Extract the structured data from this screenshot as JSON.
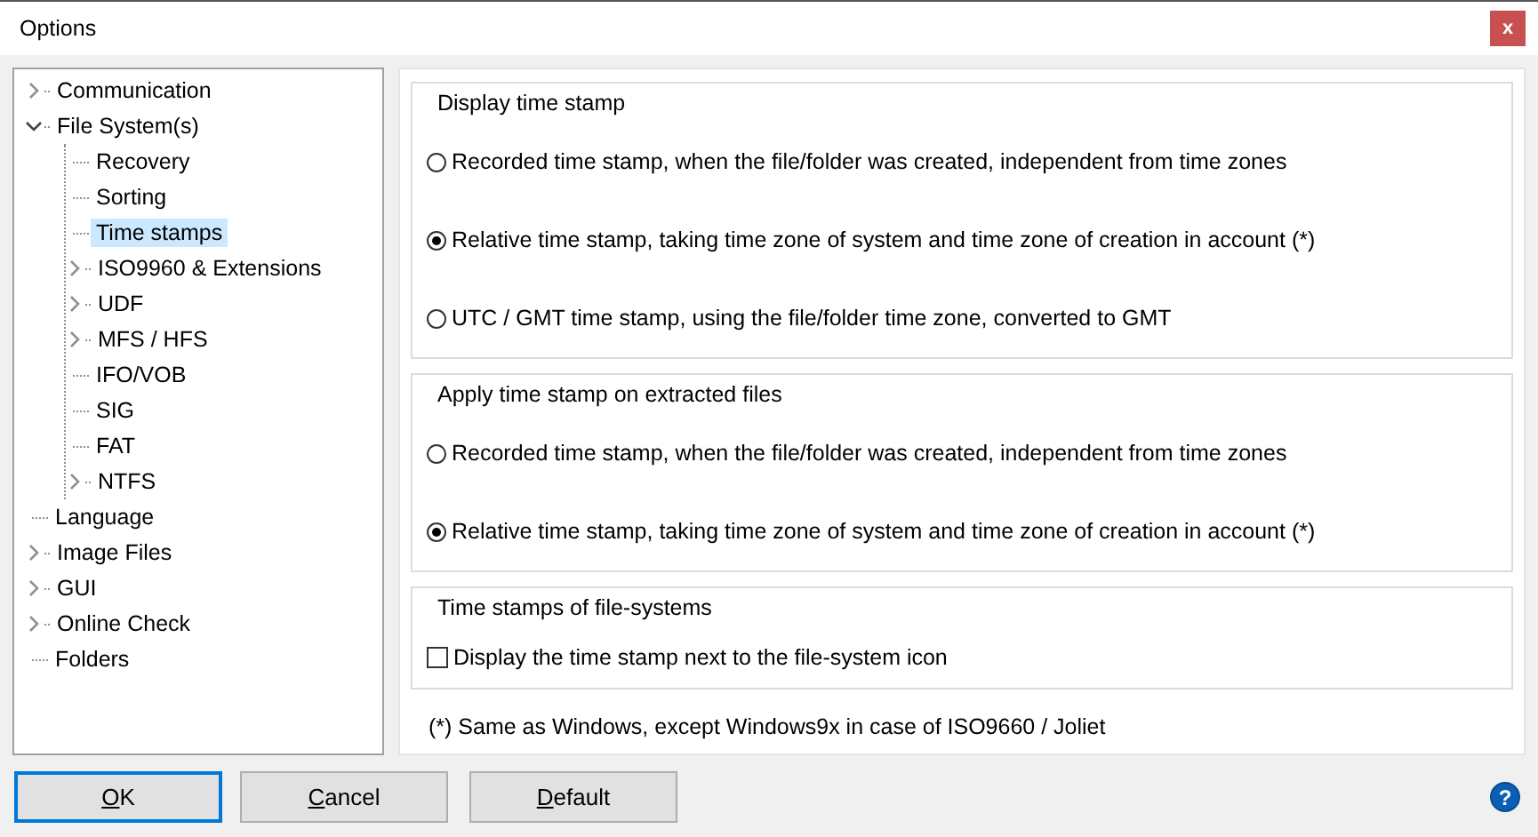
{
  "window": {
    "title": "Options",
    "close": "x"
  },
  "tree": [
    {
      "label": "Communication",
      "kind": "branch",
      "expanded": false,
      "selected": false
    },
    {
      "label": "File System(s)",
      "kind": "branch",
      "expanded": true,
      "selected": false,
      "children": [
        {
          "label": "Recovery",
          "kind": "leaf",
          "selected": false
        },
        {
          "label": "Sorting",
          "kind": "leaf",
          "selected": false
        },
        {
          "label": "Time stamps",
          "kind": "leaf",
          "selected": true
        },
        {
          "label": "ISO9960 & Extensions",
          "kind": "branch",
          "expanded": false,
          "selected": false
        },
        {
          "label": "UDF",
          "kind": "branch",
          "expanded": false,
          "selected": false
        },
        {
          "label": "MFS / HFS",
          "kind": "branch",
          "expanded": false,
          "selected": false
        },
        {
          "label": "IFO/VOB",
          "kind": "leaf",
          "selected": false
        },
        {
          "label": "SIG",
          "kind": "leaf",
          "selected": false
        },
        {
          "label": "FAT",
          "kind": "leaf",
          "selected": false
        },
        {
          "label": "NTFS",
          "kind": "branch",
          "expanded": false,
          "selected": false
        }
      ]
    },
    {
      "label": "Language",
      "kind": "leaf",
      "selected": false
    },
    {
      "label": "Image Files",
      "kind": "branch",
      "expanded": false,
      "selected": false
    },
    {
      "label": "GUI",
      "kind": "branch",
      "expanded": false,
      "selected": false
    },
    {
      "label": "Online Check",
      "kind": "branch",
      "expanded": false,
      "selected": false
    },
    {
      "label": "Folders",
      "kind": "leaf",
      "selected": false
    }
  ],
  "groups": [
    {
      "title": "Display time stamp",
      "options": [
        {
          "kind": "radio",
          "label": "Recorded time stamp, when the file/folder was created, independent from time zones",
          "selected": false
        },
        {
          "kind": "radio",
          "label": "Relative time stamp, taking time zone of system and time zone of creation in account (*)",
          "selected": true
        },
        {
          "kind": "radio",
          "label": "UTC / GMT time stamp, using the file/folder time zone, converted to GMT",
          "selected": false
        }
      ]
    },
    {
      "title": "Apply time stamp on extracted files",
      "options": [
        {
          "kind": "radio",
          "label": "Recorded time stamp, when the file/folder was created, independent from time zones",
          "selected": false
        },
        {
          "kind": "radio",
          "label": "Relative time stamp, taking time zone of system and time zone of creation in account (*)",
          "selected": true
        }
      ]
    },
    {
      "title": "Time stamps of file-systems",
      "options": [
        {
          "kind": "checkbox",
          "label": "Display the time stamp next to the file-system icon",
          "checked": false
        }
      ]
    }
  ],
  "footnote": "(*) Same as Windows, except Windows9x in case of ISO9660 / Joliet",
  "buttons": [
    {
      "label": "OK",
      "focused": true
    },
    {
      "label": "Cancel",
      "focused": false
    },
    {
      "label": "Default",
      "focused": false
    }
  ],
  "help": "?"
}
